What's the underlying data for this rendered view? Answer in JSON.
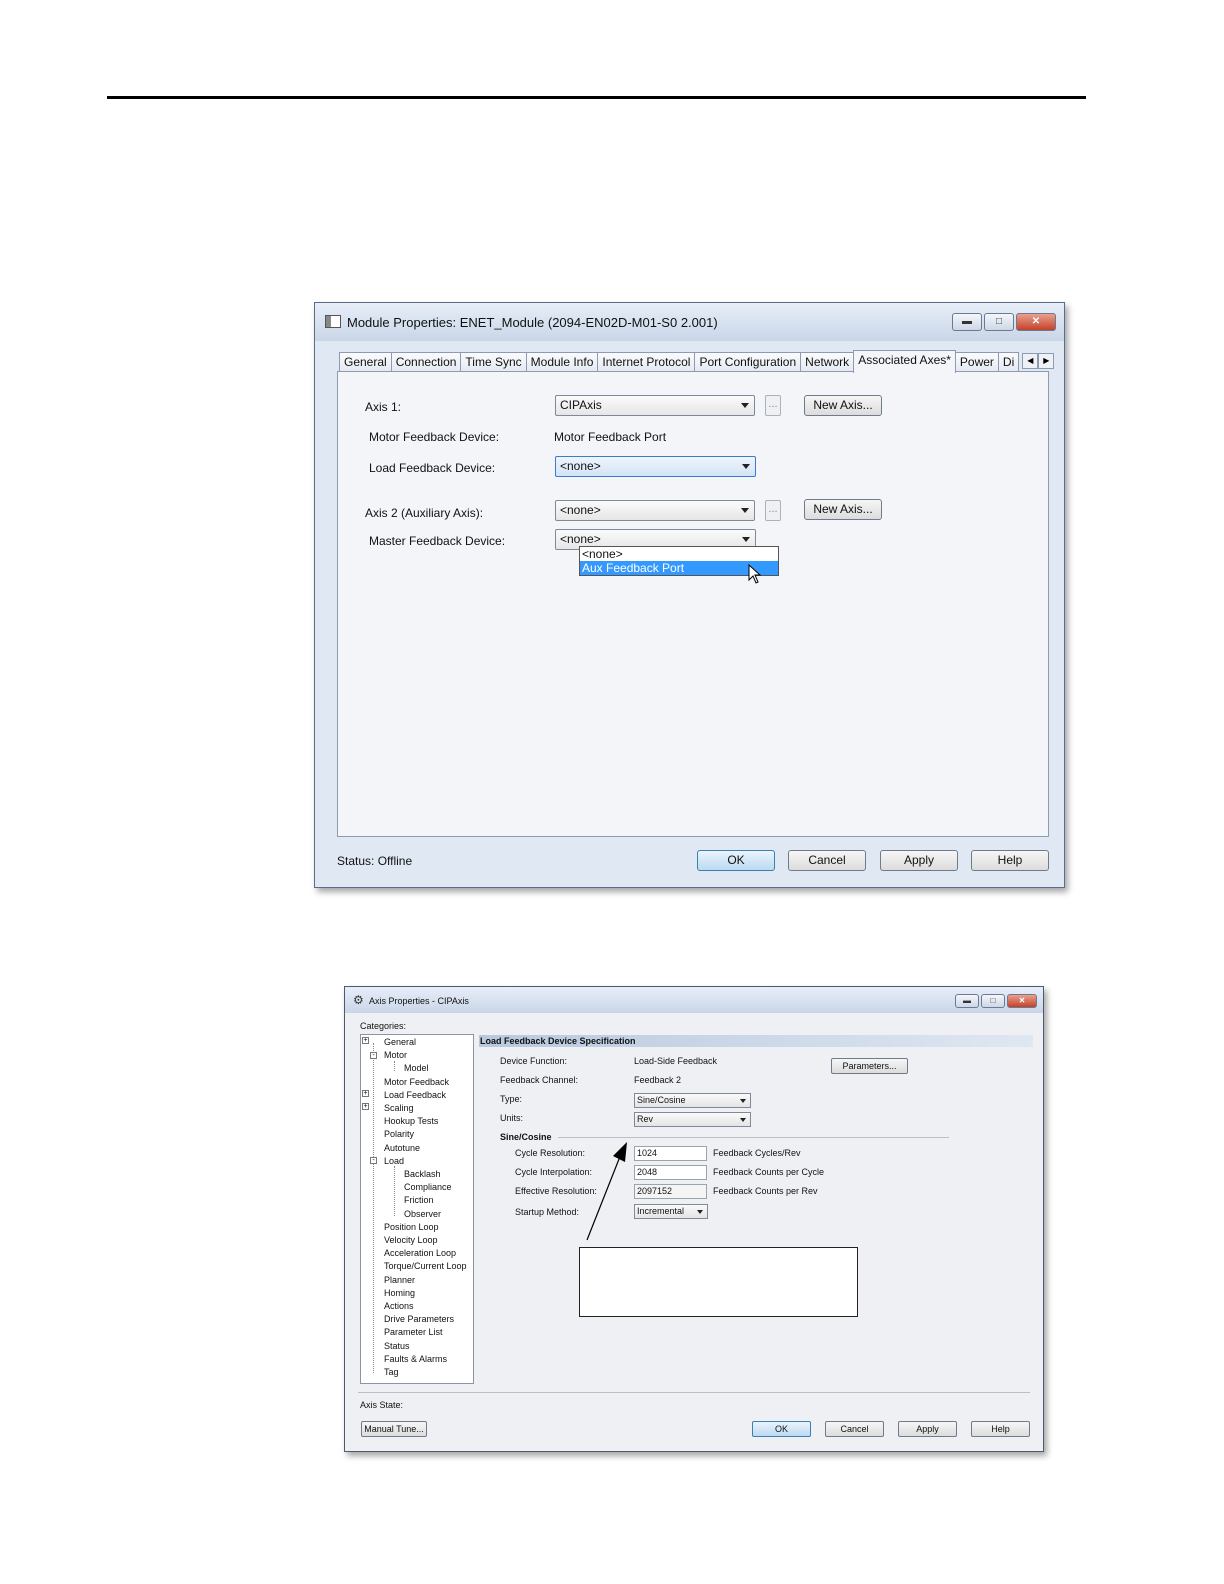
{
  "module_window": {
    "title": "Module Properties: ENET_Module (2094-EN02D-M01-S0 2.001)",
    "window_buttons": [
      "minimize-icon",
      "maximize-icon",
      "close-icon"
    ],
    "tabs": [
      {
        "label": "General"
      },
      {
        "label": "Connection"
      },
      {
        "label": "Time Sync"
      },
      {
        "label": "Module Info"
      },
      {
        "label": "Internet Protocol"
      },
      {
        "label": "Port Configuration"
      },
      {
        "label": "Network"
      },
      {
        "label": "Associated Axes*",
        "active": true
      },
      {
        "label": "Power"
      },
      {
        "label": "Di"
      }
    ],
    "axis1_label": "Axis 1:",
    "axis1_value": "CIPAxis",
    "browse_label": "...",
    "new_axis_label": "New Axis...",
    "motor_feedback_label": "Motor Feedback Device:",
    "motor_feedback_value": "Motor Feedback Port",
    "load_feedback_label": "Load Feedback Device:",
    "load_feedback_value": "<none>",
    "load_feedback_options": [
      "<none>",
      "Aux Feedback Port"
    ],
    "axis2_label": "Axis 2  (Auxiliary Axis):",
    "axis2_value": "<none>",
    "master_feedback_label": "Master Feedback Device:",
    "master_feedback_value": "<none>",
    "status_label": "Status:  Offline",
    "buttons": {
      "ok": "OK",
      "cancel": "Cancel",
      "apply": "Apply",
      "help": "Help"
    }
  },
  "axis_window": {
    "title": "Axis Properties - CIPAxis",
    "categories_label": "Categories:",
    "tree": [
      {
        "label": "General",
        "level": 0
      },
      {
        "label": "Motor",
        "level": 0
      },
      {
        "label": "Model",
        "level": 1
      },
      {
        "label": "Motor Feedback",
        "level": 0
      },
      {
        "label": "Load Feedback",
        "level": 0
      },
      {
        "label": "Scaling",
        "level": 0
      },
      {
        "label": "Hookup Tests",
        "level": 0
      },
      {
        "label": "Polarity",
        "level": 0
      },
      {
        "label": "Autotune",
        "level": 0
      },
      {
        "label": "Load",
        "level": 0
      },
      {
        "label": "Backlash",
        "level": 1
      },
      {
        "label": "Compliance",
        "level": 1
      },
      {
        "label": "Friction",
        "level": 1
      },
      {
        "label": "Observer",
        "level": 1
      },
      {
        "label": "Position Loop",
        "level": 0
      },
      {
        "label": "Velocity Loop",
        "level": 0
      },
      {
        "label": "Acceleration Loop",
        "level": 0
      },
      {
        "label": "Torque/Current Loop",
        "level": 0
      },
      {
        "label": "Planner",
        "level": 0
      },
      {
        "label": "Homing",
        "level": 0
      },
      {
        "label": "Actions",
        "level": 0
      },
      {
        "label": "Drive Parameters",
        "level": 0
      },
      {
        "label": "Parameter List",
        "level": 0
      },
      {
        "label": "Status",
        "level": 0
      },
      {
        "label": "Faults & Alarms",
        "level": 0
      },
      {
        "label": "Tag",
        "level": 0
      }
    ],
    "section_title": "Load Feedback Device Specification",
    "device_function_label": "Device Function:",
    "device_function_value": "Load-Side Feedback",
    "parameters_button": "Parameters...",
    "feedback_channel_label": "Feedback Channel:",
    "feedback_channel_value": "Feedback 2",
    "type_label": "Type:",
    "type_value": "Sine/Cosine",
    "units_label": "Units:",
    "units_value": "Rev",
    "group_label": "Sine/Cosine",
    "cycle_resolution_label": "Cycle Resolution:",
    "cycle_resolution_value": "1024",
    "cycle_resolution_unit": "Feedback Cycles/Rev",
    "cycle_interpolation_label": "Cycle Interpolation:",
    "cycle_interpolation_value": "2048",
    "cycle_interpolation_unit": "Feedback Counts per Cycle",
    "effective_resolution_label": "Effective Resolution:",
    "effective_resolution_value": "2097152",
    "effective_resolution_unit": "Feedback Counts per Rev",
    "startup_method_label": "Startup Method:",
    "startup_method_value": "Incremental",
    "axis_state_label": "Axis State:",
    "buttons": {
      "manual_tune": "Manual Tune...",
      "ok": "OK",
      "cancel": "Cancel",
      "apply": "Apply",
      "help": "Help"
    }
  }
}
